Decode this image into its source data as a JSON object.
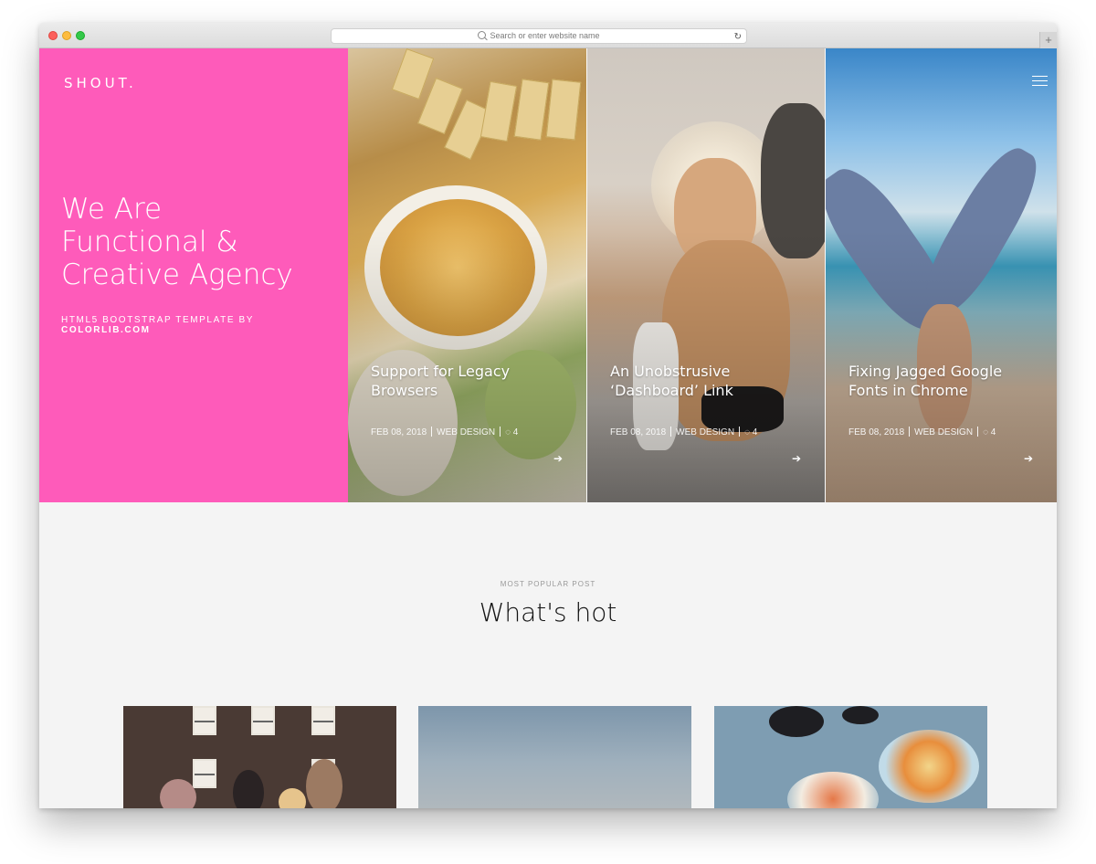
{
  "browser": {
    "address_placeholder": "Search or enter website name",
    "reload_icon": "reload-icon",
    "newtab_label": "+"
  },
  "brand": {
    "logo": "SHOUT.",
    "accent_color": "#fe5bba"
  },
  "hero": {
    "headline": [
      "We Are",
      "Functional &",
      "Creative Agency"
    ],
    "byline": "HTML5 BOOTSTRAP TEMPLATE BY",
    "byline_link": "COLORLIB.COM"
  },
  "posts": [
    {
      "title": "Support for Legacy Browsers",
      "date": "FEB 08, 2018",
      "category": "WEB DESIGN",
      "comments": "4"
    },
    {
      "title": "An Unobstrusive ‘Dashboard’ Link",
      "date": "FEB 08, 2018",
      "category": "WEB DESIGN",
      "comments": "4"
    },
    {
      "title": "Fixing Jagged Google Fonts in Chrome",
      "date": "FEB 08, 2018",
      "category": "WEB DESIGN",
      "comments": "4"
    }
  ],
  "popular": {
    "kicker": "MOST POPULAR POST",
    "title": "What's hot"
  }
}
